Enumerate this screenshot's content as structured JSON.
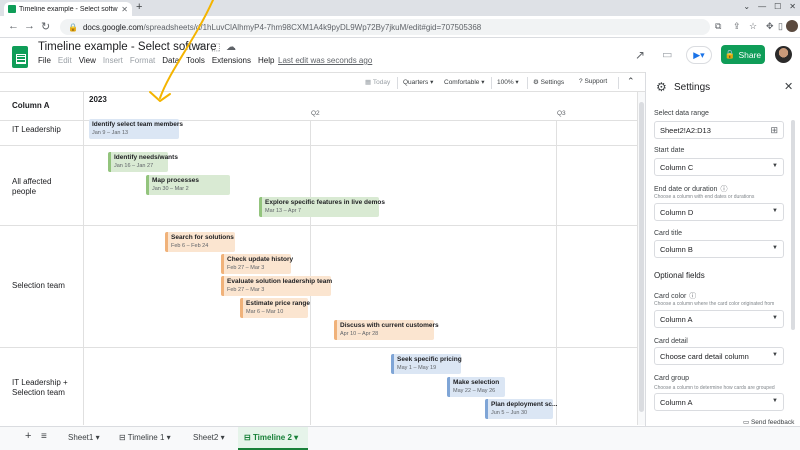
{
  "browser": {
    "tab_title": "Timeline example - Select softw",
    "url_host": "docs.google.com",
    "url_path": "/spreadsheets/d/1hLuvClAlhmyP4-7hm98CXM1A4k9pyDL9Wp72By7jkuM/edit#gid=707505368"
  },
  "doc": {
    "title": "Timeline example - Select software",
    "menu": [
      "File",
      "Edit",
      "View",
      "Insert",
      "Format",
      "Data",
      "Tools",
      "Extensions",
      "Help"
    ],
    "menu_dim": [
      false,
      true,
      false,
      true,
      true,
      false,
      false,
      false,
      false
    ],
    "last_edit": "Last edit was seconds ago",
    "share_label": "Share"
  },
  "toolbar": {
    "today": "Today",
    "quarters": "Quarters",
    "comfortable": "Comfortable",
    "zoom": "100%",
    "settings": "Settings",
    "support": "Support"
  },
  "timeline": {
    "column_header": "Column A",
    "year": "2023",
    "quarters": [
      "Q2",
      "Q3"
    ],
    "rows": [
      "IT Leadership",
      "All affected people",
      "Selection team",
      "IT Leadership + Selection team"
    ],
    "cards": [
      {
        "title": "Identify select team members",
        "dates": "Jan 9 – Jan 13",
        "color": "blue"
      },
      {
        "title": "Identify needs/wants",
        "dates": "Jan 16 – Jan 27",
        "color": "green"
      },
      {
        "title": "Map processes",
        "dates": "Jan 30 – Mar 2",
        "color": "green"
      },
      {
        "title": "Explore specific features in live demos",
        "dates": "Mar 13 – Apr 7",
        "color": "green"
      },
      {
        "title": "Search for solutions",
        "dates": "Feb 6 – Feb 24",
        "color": "orange"
      },
      {
        "title": "Check update history",
        "dates": "Feb 27 – Mar 3",
        "color": "orange"
      },
      {
        "title": "Evaluate solution leadership team",
        "dates": "Feb 27 – Mar 3",
        "color": "orange"
      },
      {
        "title": "Estimate price range",
        "dates": "Mar 6 – Mar 10",
        "color": "orange"
      },
      {
        "title": "Discuss with current customers",
        "dates": "Apr 10 – Apr 28",
        "color": "orange"
      },
      {
        "title": "Seek specific pricing",
        "dates": "May 1 – May 19",
        "color": "blue"
      },
      {
        "title": "Make selection",
        "dates": "May 22 – May 26",
        "color": "blue"
      },
      {
        "title": "Plan deployment sc...",
        "dates": "Jun 5 – Jun 30",
        "color": "blue"
      }
    ]
  },
  "sheets": {
    "tabs": [
      "Sheet1",
      "Timeline 1",
      "Sheet2",
      "Timeline 2"
    ]
  },
  "settings": {
    "title": "Settings",
    "data_range_label": "Select data range",
    "data_range_value": "Sheet2!A2:D13",
    "start_label": "Start date",
    "start_value": "Column C",
    "end_label": "End date or duration",
    "end_hint": "Choose a column with end dates or durations",
    "end_value": "Column D",
    "card_title_label": "Card title",
    "card_title_value": "Column B",
    "optional_heading": "Optional fields",
    "color_label": "Card color",
    "color_hint": "Choose a column where the card color originated from",
    "color_value": "Column A",
    "detail_label": "Card detail",
    "detail_value": "Choose card detail column",
    "group_label": "Card group",
    "group_hint": "Choose a column to determine how cards are grouped",
    "group_value": "Column A",
    "feedback": "Send feedback"
  },
  "colors": {
    "sheets_green": "#0f9d58",
    "card_blue": "#dbe6f4",
    "card_green": "#d9ead3",
    "card_orange": "#fbe5d0",
    "annotation_arrow": "#f4b400"
  }
}
